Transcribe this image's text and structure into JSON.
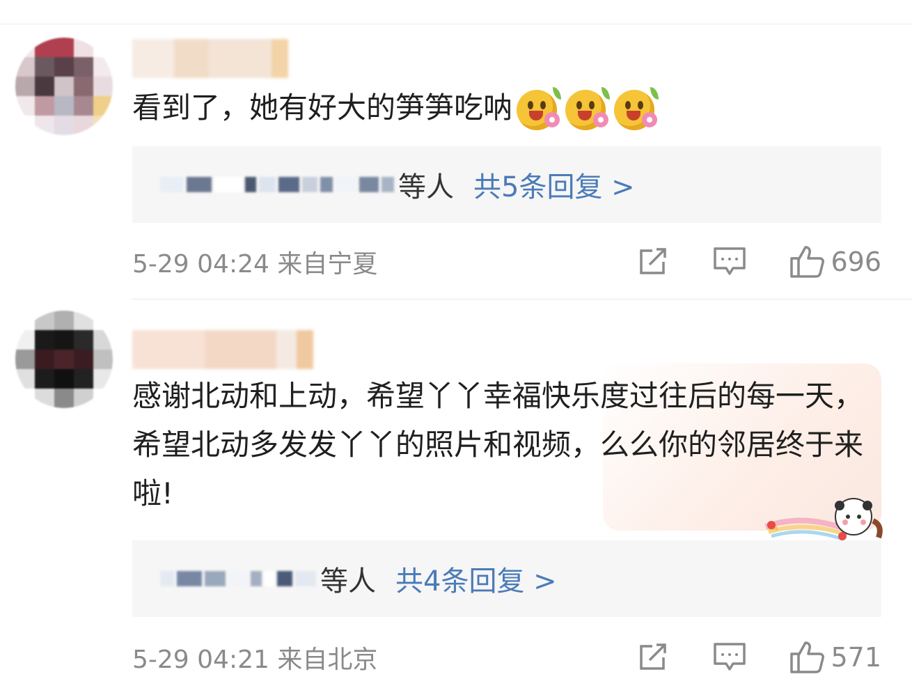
{
  "comments": [
    {
      "text": "看到了，她有好大的笋笋吃呐",
      "emoji_icons": [
        "laugh-flower-icon",
        "laugh-flower-icon",
        "laugh-flower-icon"
      ],
      "reply_suffix": "等人",
      "reply_link": "共5条回复 >",
      "time": "5-29 04:24 来自宁夏",
      "like_count": "696"
    },
    {
      "text": "感谢北动和上动，希望丫丫幸福快乐度过往后的每一天，希望北动多发发丫丫的照片和视频，么么你的邻居终于来啦!",
      "reply_suffix": "等人",
      "reply_link": "共4条回复 >",
      "time": "5-29 04:21 来自北京",
      "like_count": "571"
    }
  ],
  "icons": {
    "share": "share-icon",
    "comment": "comment-icon",
    "like": "thumbs-up-icon"
  },
  "colors": {
    "link": "#4a7bb8",
    "meta": "#8a8a8a",
    "reply_bg": "#f6f6f6"
  }
}
